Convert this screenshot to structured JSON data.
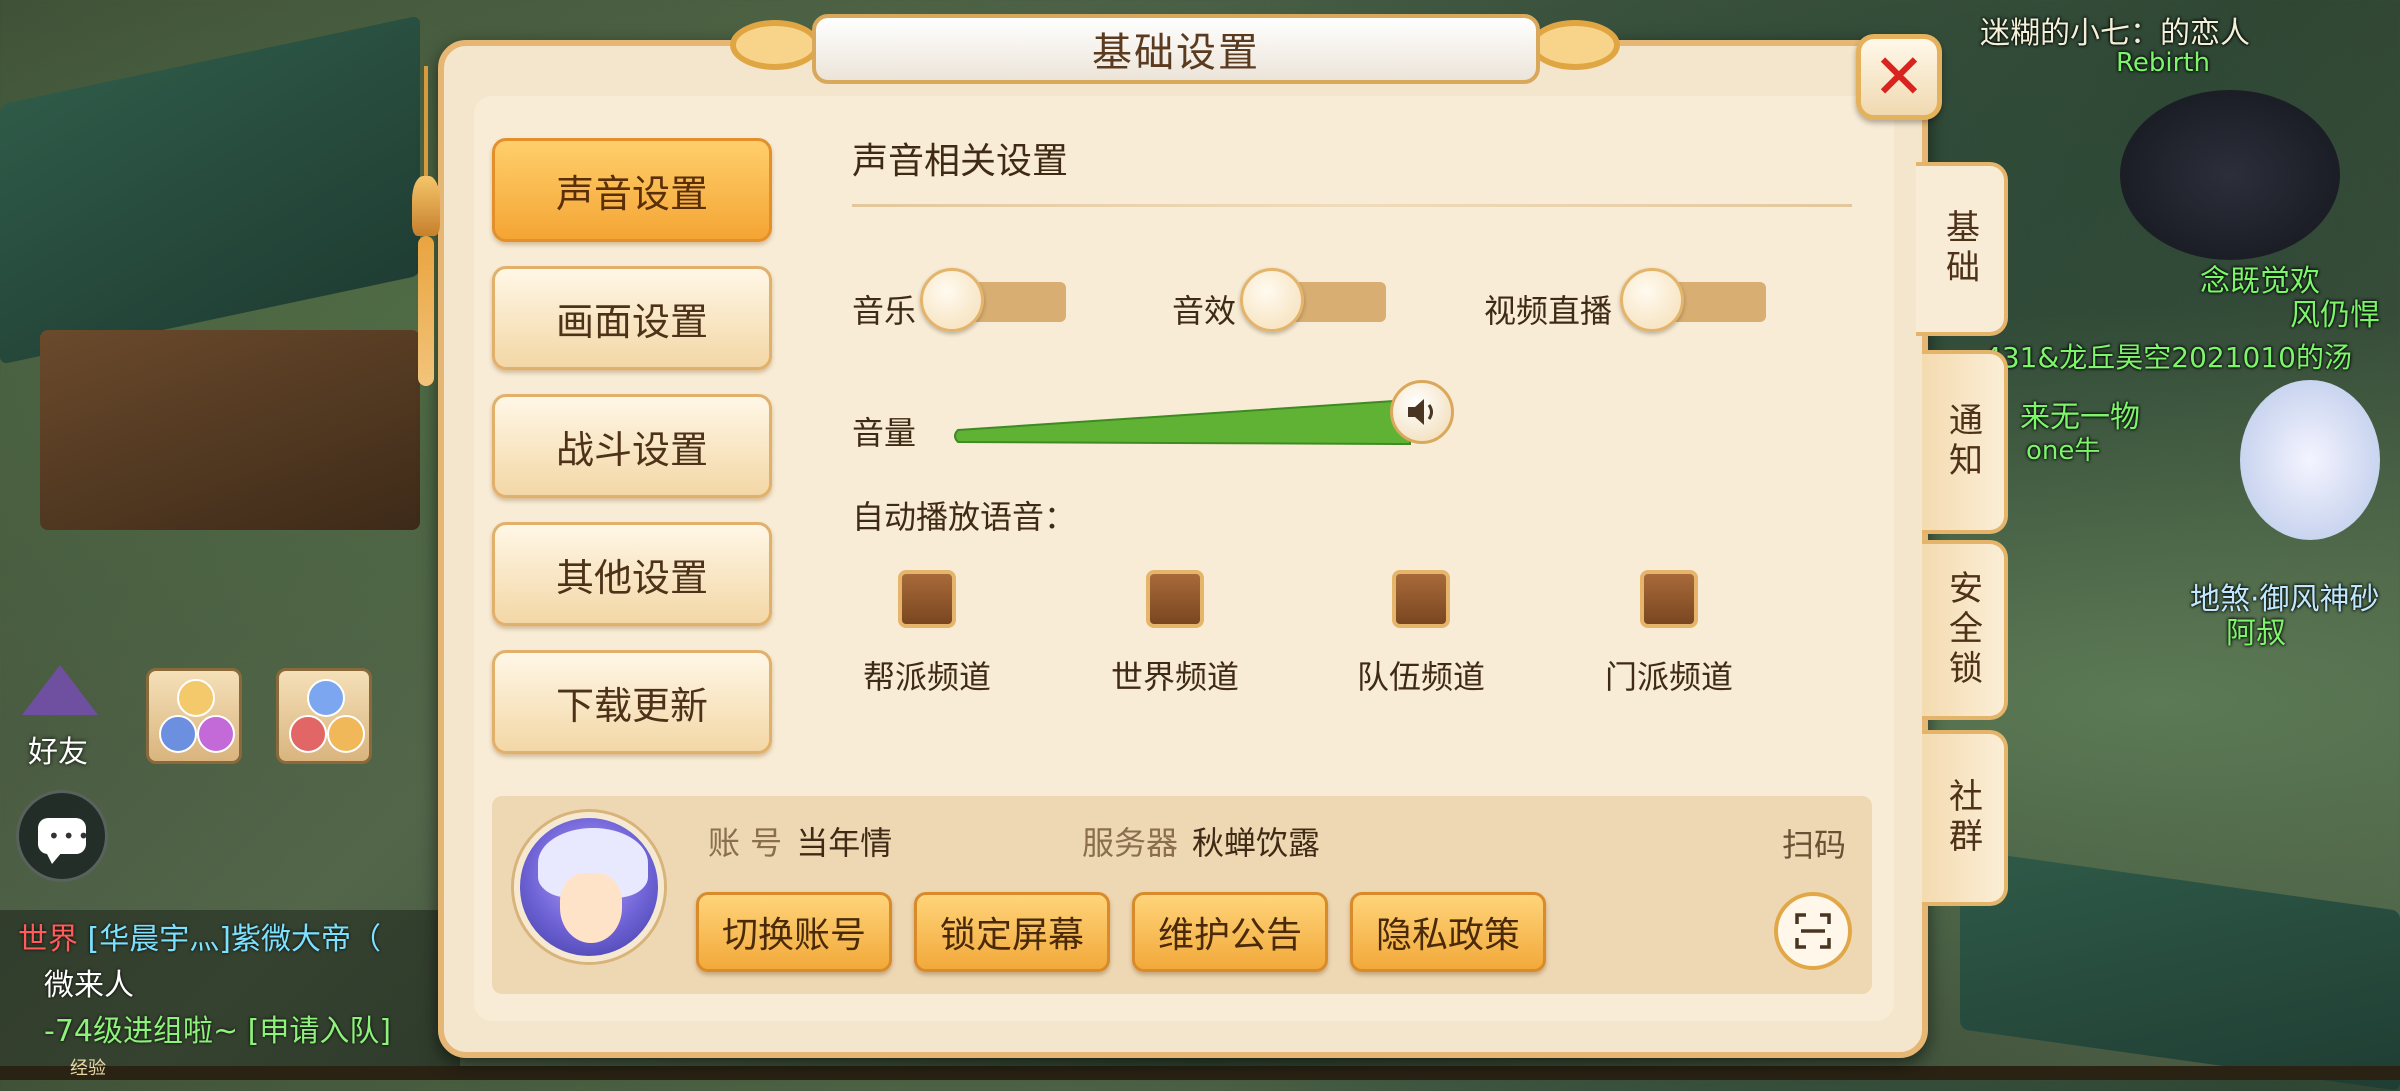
{
  "dialog": {
    "title": "基础设置",
    "close_icon": "close-icon"
  },
  "menu": {
    "items": [
      {
        "label": "声音设置",
        "active": true
      },
      {
        "label": "画面设置",
        "active": false
      },
      {
        "label": "战斗设置",
        "active": false
      },
      {
        "label": "其他设置",
        "active": false
      },
      {
        "label": "下载更新",
        "active": false
      }
    ]
  },
  "tabs": [
    {
      "label": "基础",
      "active": true
    },
    {
      "label": "通知",
      "active": false
    },
    {
      "label": "安全锁",
      "active": false
    },
    {
      "label": "社群",
      "active": false
    }
  ],
  "sound": {
    "section_title": "声音相关设置",
    "toggles": [
      {
        "label": "音乐",
        "on": false
      },
      {
        "label": "音效",
        "on": false
      },
      {
        "label": "视频直播",
        "on": false
      }
    ],
    "volume_label": "音量",
    "volume_level": 1.0,
    "auto_play_label": "自动播放语音：",
    "channels": [
      {
        "label": "帮派频道",
        "checked": false
      },
      {
        "label": "世界频道",
        "checked": false
      },
      {
        "label": "队伍频道",
        "checked": false
      },
      {
        "label": "门派频道",
        "checked": false
      }
    ]
  },
  "account": {
    "account_key": "账 号",
    "account_value": "当年情",
    "server_key": "服务器",
    "server_value": "秋蝉饮露",
    "scan_label": "扫码",
    "buttons": [
      "切换账号",
      "锁定屏幕",
      "维护公告",
      "隐私政策"
    ]
  },
  "hud": {
    "friend_label": "好友",
    "exp_label": "经验"
  },
  "chat": {
    "lines": [
      {
        "channel": "世界",
        "text": "[华晨宇灬]紫微大帝（"
      },
      {
        "channel": "",
        "text": "微来人"
      },
      {
        "channel": "",
        "text": "-74级进组啦~ [申请入队]"
      }
    ]
  },
  "world_labels": [
    {
      "text": "迷糊的小七：的恋人"
    },
    {
      "text": "Rebirth"
    },
    {
      "text": "念既觉欢"
    },
    {
      "text": "风仍悍"
    },
    {
      "text": "431&龙丘昊空2021010的汤"
    },
    {
      "text": "来无一物"
    },
    {
      "text": "one牛"
    },
    {
      "text": "地煞·御风神砂"
    },
    {
      "text": "阿叔"
    }
  ],
  "colors": {
    "accent": "#f2a93a",
    "panel": "#f8ecd6",
    "close": "#d8231e",
    "volume": "#5fb234"
  }
}
